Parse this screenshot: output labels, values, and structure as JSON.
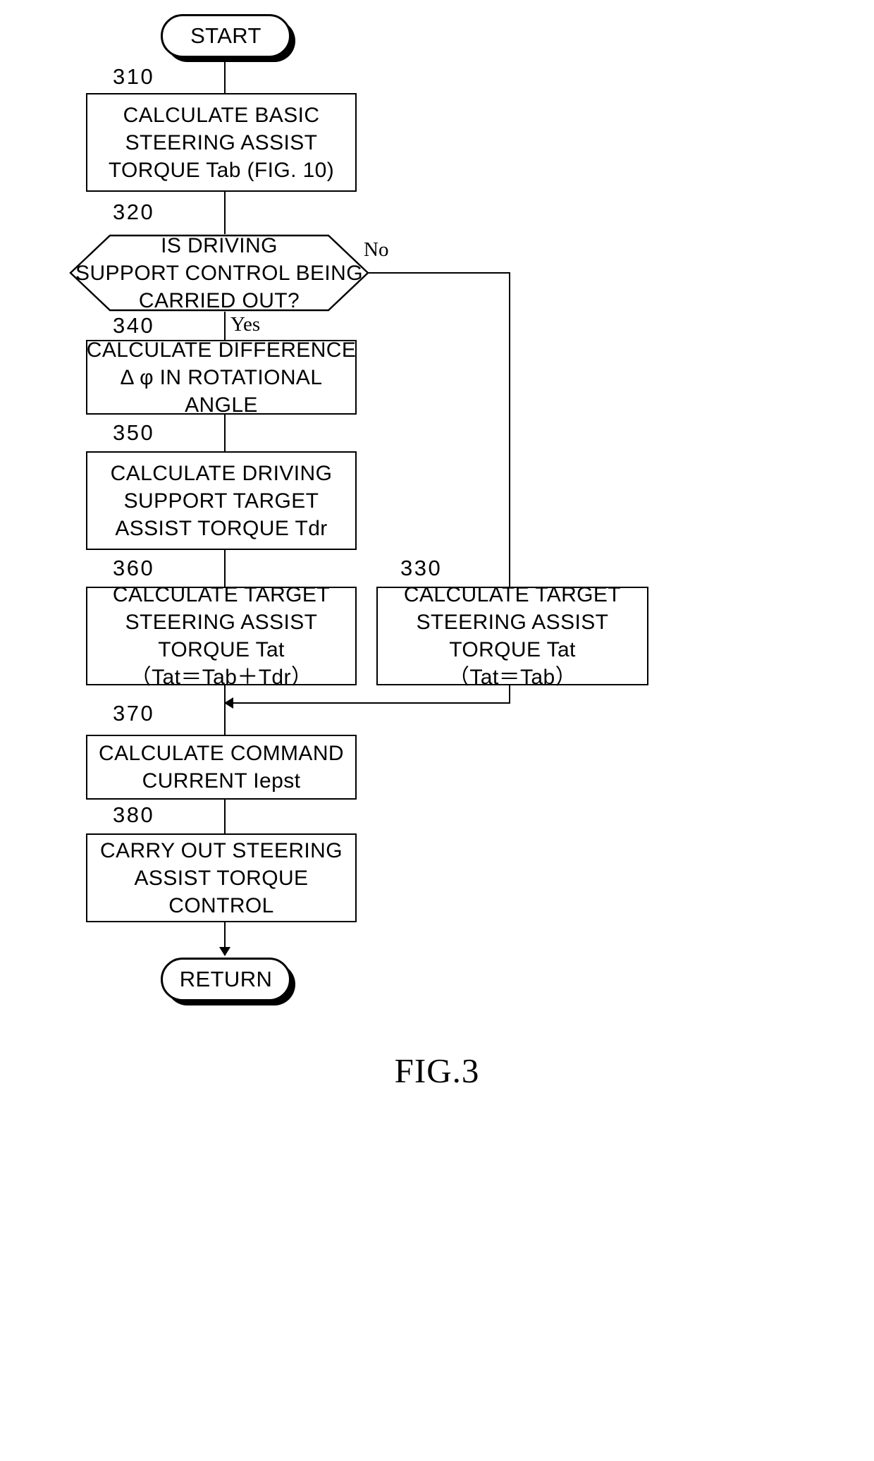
{
  "figure": {
    "caption": "FIG.3"
  },
  "terminals": {
    "start": "START",
    "return": "RETURN"
  },
  "branches": {
    "no": "No",
    "yes": "Yes"
  },
  "steps": [
    {
      "number": "310",
      "shape": "process",
      "lines": [
        "CALCULATE BASIC",
        "STEERING ASSIST",
        "TORQUE Tab (FIG. 10)"
      ]
    },
    {
      "number": "320",
      "shape": "decision",
      "lines": [
        "IS DRIVING",
        "SUPPORT CONTROL BEING",
        "CARRIED OUT?"
      ]
    },
    {
      "number": "340",
      "shape": "process",
      "lines": [
        "CALCULATE DIFFERENCE",
        "Δ φ IN ROTATIONAL",
        "ANGLE"
      ]
    },
    {
      "number": "350",
      "shape": "process",
      "lines": [
        "CALCULATE DRIVING",
        "SUPPORT TARGET",
        "ASSIST TORQUE Tdr"
      ]
    },
    {
      "number": "360",
      "shape": "process",
      "lines": [
        "CALCULATE TARGET",
        "STEERING ASSIST",
        "TORQUE Tat",
        "（Tat＝Tab＋Tdr）"
      ]
    },
    {
      "number": "330",
      "shape": "process",
      "lines": [
        "CALCULATE TARGET",
        "STEERING ASSIST",
        "TORQUE Tat",
        "（Tat＝Tab）"
      ]
    },
    {
      "number": "370",
      "shape": "process",
      "lines": [
        "CALCULATE COMMAND",
        "CURRENT Iepst"
      ]
    },
    {
      "number": "380",
      "shape": "process",
      "lines": [
        "CARRY OUT STEERING",
        "ASSIST TORQUE",
        "CONTROL"
      ]
    }
  ]
}
